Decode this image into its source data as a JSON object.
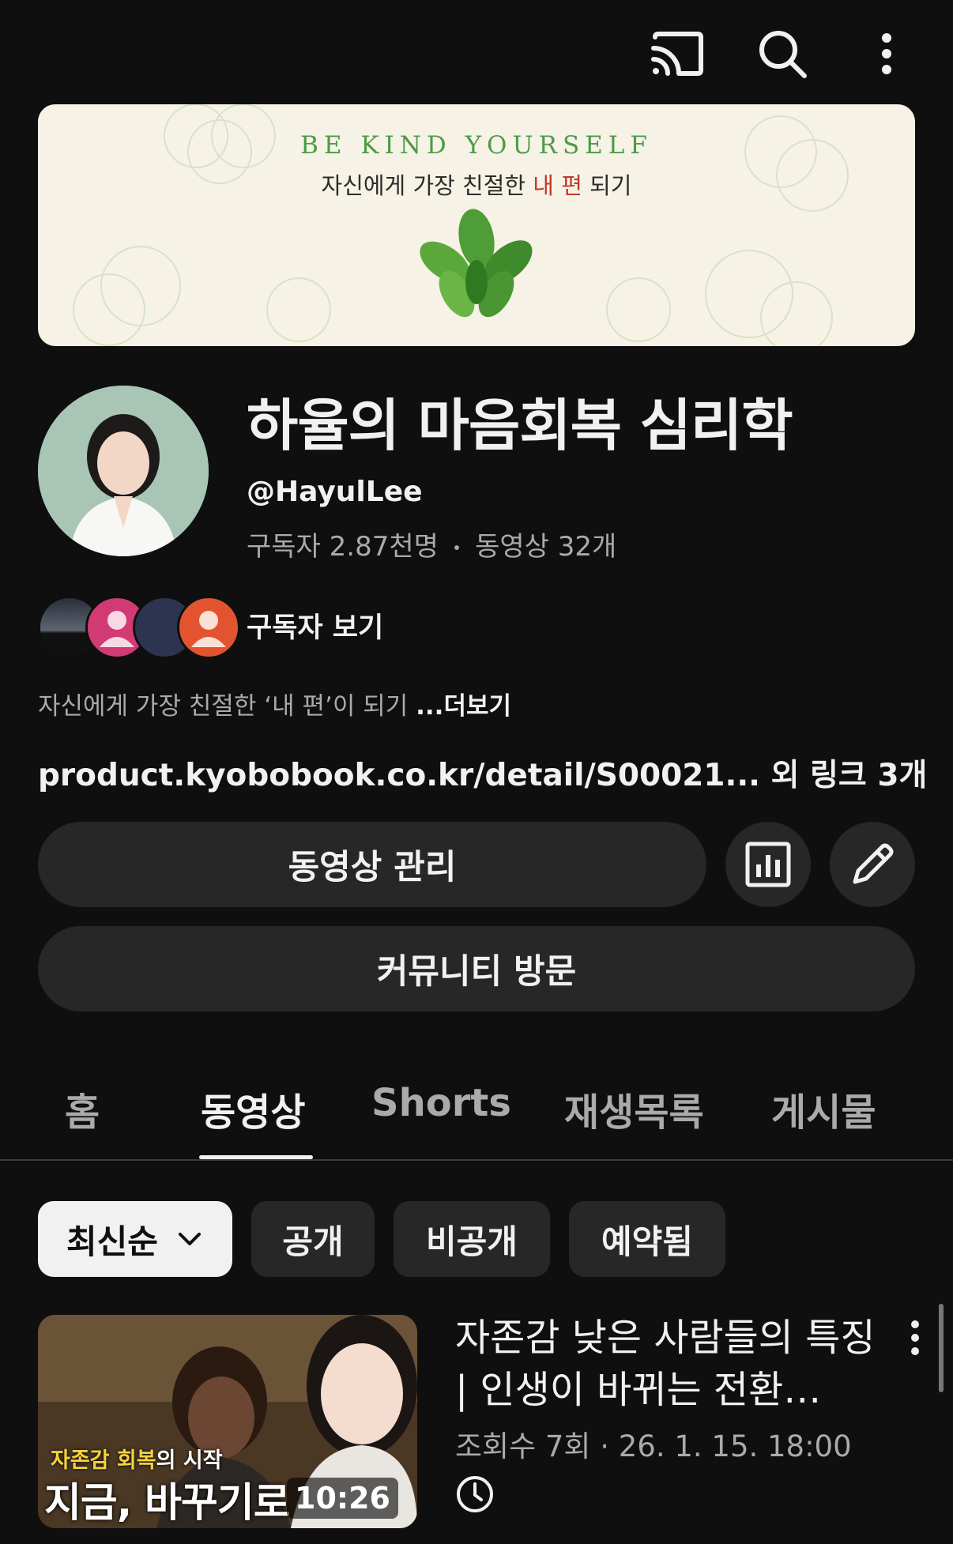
{
  "topbar": {
    "icons": [
      "cast-icon",
      "search-icon",
      "more-vert-icon"
    ]
  },
  "banner": {
    "title": "BE KIND YOURSELF",
    "subtitle_pre": "자신에게 가장 친절한 ",
    "subtitle_hl": "내 편",
    "subtitle_post": " 되기"
  },
  "channel": {
    "name": "하율의 마음회복 심리학",
    "handle": "@HayulLee",
    "subscribers": "구독자 2.87천명",
    "videos": "동영상 32개",
    "view_subscribers": "구독자 보기",
    "description": "자신에게 가장 친절한 ‘내 편’이 되기",
    "more": "...더보기",
    "link": "product.kyobobook.co.kr/detail/S00021...",
    "link_extra": "외 링크 3개"
  },
  "buttons": {
    "manage": "동영상 관리",
    "community": "커뮤니티 방문"
  },
  "tabs": [
    {
      "label": "홈",
      "active": false
    },
    {
      "label": "동영상",
      "active": true
    },
    {
      "label": "Shorts",
      "active": false
    },
    {
      "label": "재생목록",
      "active": false
    },
    {
      "label": "게시물",
      "active": false
    }
  ],
  "filters": {
    "sort": "최신순",
    "chips": [
      "공개",
      "비공개",
      "예약됨"
    ]
  },
  "video": {
    "thumb_tag_hl": "자존감 회복",
    "thumb_tag_rest": "의 시작",
    "thumb_title": "지금, 바꾸기로",
    "duration": "10:26",
    "title": "자존감 낮은 사람들의 특징 | 인생이 바뀌는 전환…",
    "meta": "조회수 7회 · 26. 1. 15. 18:00"
  },
  "colors": {
    "background": "#0f0f0f",
    "button": "#272727",
    "text": "#f1f1f1",
    "secondary_text": "#aaaaaa",
    "banner_green": "#4e9a47",
    "banner_red": "#c0392b"
  }
}
